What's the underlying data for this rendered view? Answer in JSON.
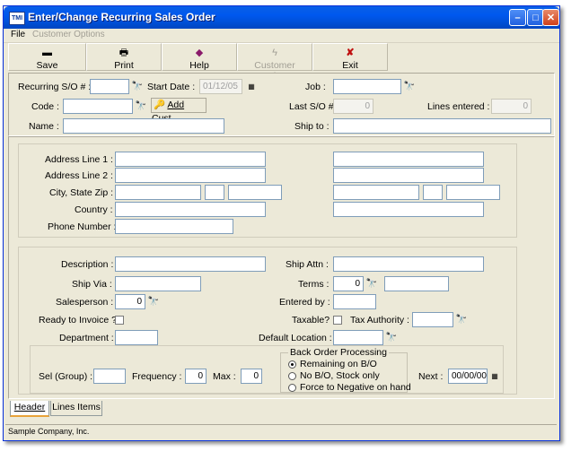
{
  "window": {
    "title": "Enter/Change Recurring Sales Order",
    "icon_label": "TMI"
  },
  "menu": {
    "items": [
      "File",
      "Customer Options"
    ]
  },
  "toolbar": {
    "save": "Save",
    "print": "Print",
    "help": "Help",
    "customer_options": "Customer Options",
    "exit": "Exit"
  },
  "header": {
    "recurring_so_label": "Recurring S/O # :",
    "recurring_so_value": "",
    "start_date_label": "Start  Date :",
    "start_date_value": "01/12/05",
    "job_label": "Job :",
    "code_label": "Code :",
    "add_cust": "Add Cust",
    "last_so_label": "Last S/O #",
    "last_so_value": "0",
    "lines_entered_label": "Lines entered :",
    "lines_entered_value": "0",
    "name_label": "Name :",
    "ship_to_label": "Ship to :"
  },
  "address": {
    "line1_label": "Address Line 1 :",
    "line2_label": "Address Line 2 :",
    "city_label": "City, State Zip :",
    "country_label": "Country :",
    "phone_label": "Phone Number :"
  },
  "order": {
    "description_label": "Description :",
    "ship_attn_label": "Ship Attn :",
    "ship_via_label": "Ship Via :",
    "terms_label": "Terms :",
    "terms_value": "0",
    "salesperson_label": "Salesperson :",
    "salesperson_value": "0",
    "entered_by_label": "Entered by :",
    "ready_invoice_label": "Ready to Invoice ?",
    "taxable_label": "Taxable?",
    "tax_authority_label": "Tax Authority :",
    "department_label": "Department :",
    "default_location_label": "Default Location :"
  },
  "recurring": {
    "sel_group_label": "Sel (Group) :",
    "frequency_label": "Frequency :",
    "frequency_value": "0",
    "max_label": "Max :",
    "max_value": "0",
    "next_label": "Next :",
    "next_value": "00/00/00"
  },
  "back_order": {
    "title": "Back Order Processing",
    "options": [
      "Remaining on B/O",
      "No B/O, Stock only",
      "Force to Negative on hand"
    ],
    "selected": "Remaining on B/O"
  },
  "tabs": [
    "Header",
    "Lines Items"
  ],
  "active_tab": "Header",
  "status": {
    "company": "Sample Company, Inc."
  }
}
